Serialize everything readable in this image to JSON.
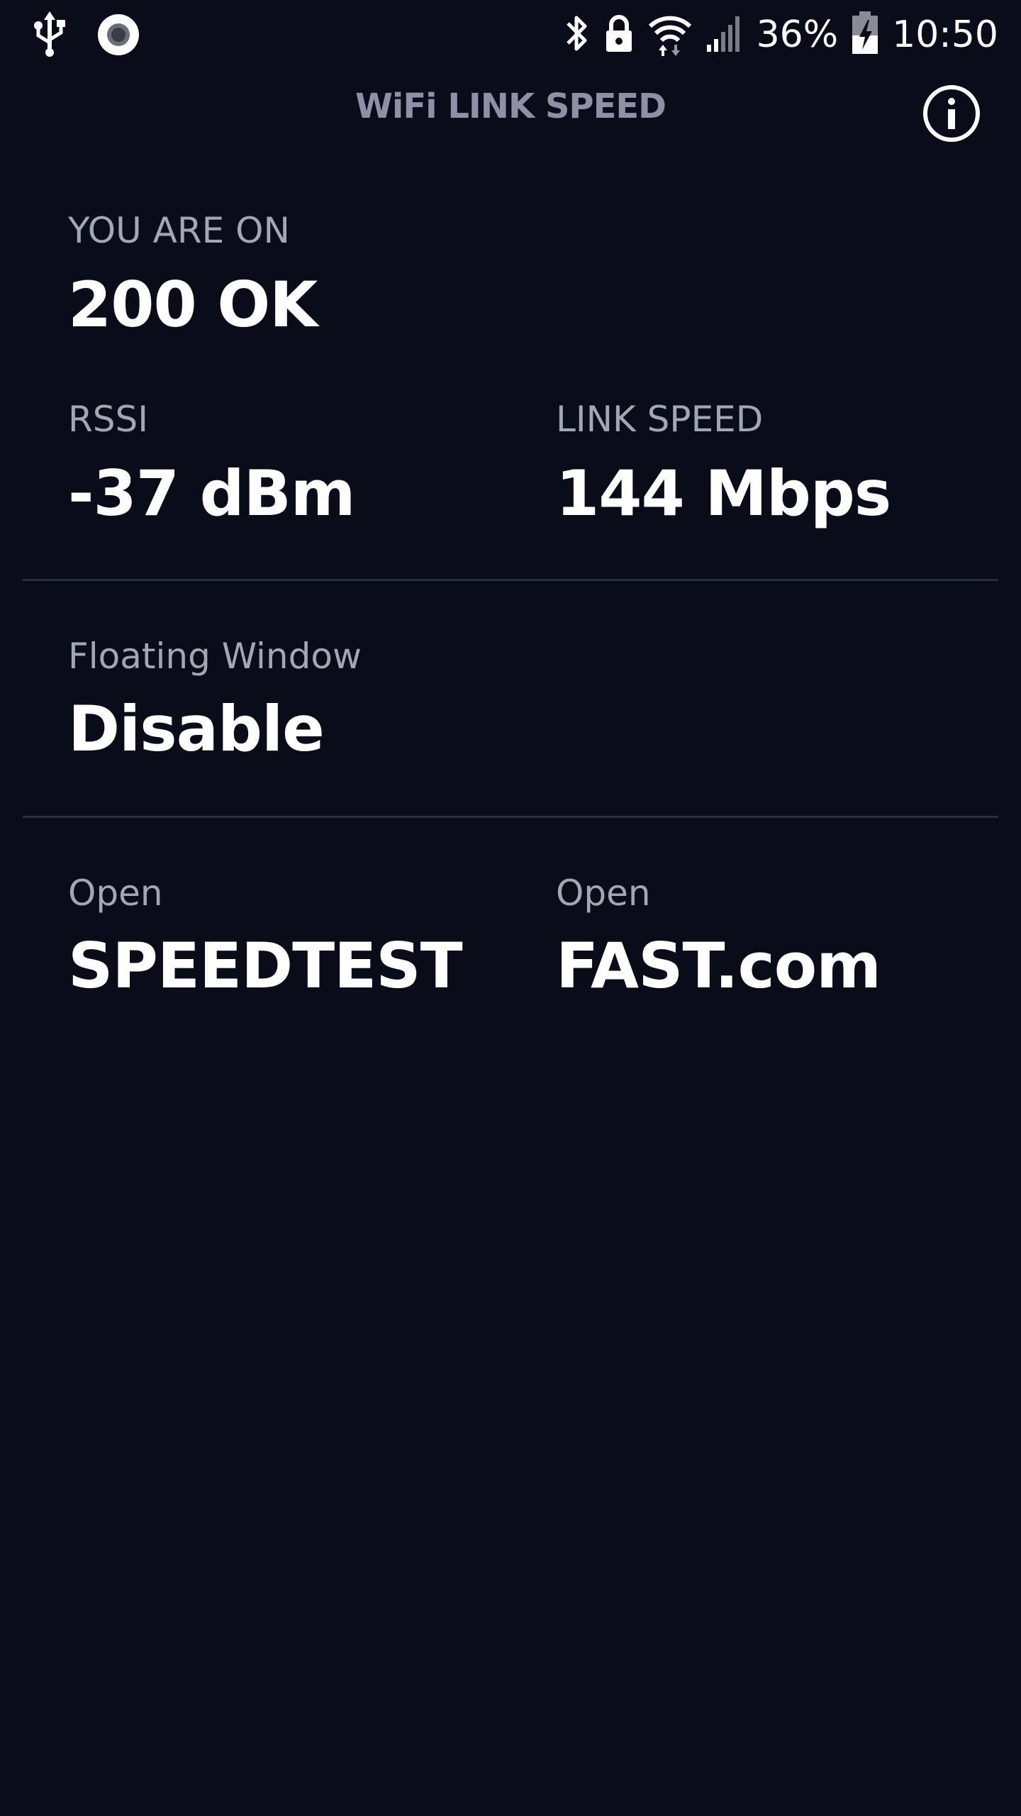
{
  "status_bar": {
    "battery_percent": "36%",
    "time": "10:50",
    "icons": [
      "usb-icon",
      "record-icon",
      "bluetooth-icon",
      "lock-icon",
      "wifi-icon",
      "cell-signal-icon",
      "battery-charging-icon"
    ]
  },
  "app_bar": {
    "title": "WiFi LINK SPEED",
    "info_icon": "info-icon"
  },
  "network": {
    "label": "YOU ARE ON",
    "ssid": "200 OK"
  },
  "rssi": {
    "label": "RSSI",
    "value": "-37 dBm"
  },
  "link_speed": {
    "label": "LINK SPEED",
    "value": "144 Mbps"
  },
  "floating_window": {
    "label": "Floating Window",
    "value": "Disable"
  },
  "speedtest": {
    "label": "Open",
    "value": "SPEEDTEST"
  },
  "fast": {
    "label": "Open",
    "value": "FAST.com"
  },
  "colors": {
    "background": "#0a0c1a",
    "title": "#8f90a6",
    "label": "#a3a6b5",
    "value": "#ffffff",
    "divider": "#2a2d3d"
  }
}
